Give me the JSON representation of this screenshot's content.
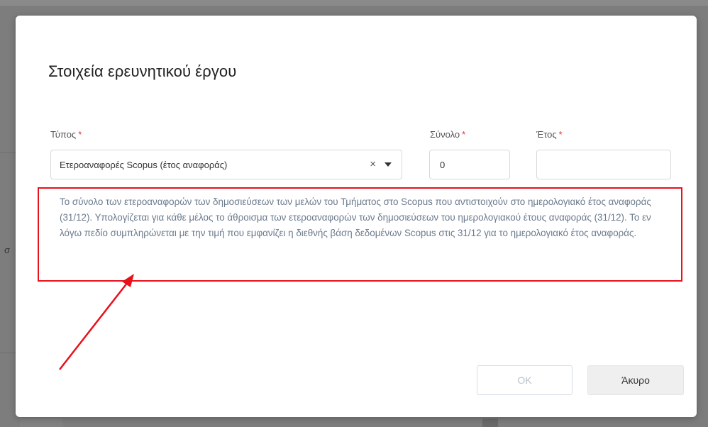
{
  "dialog": {
    "title": "Στοιχεία ερευνητικού έργου",
    "type_label": "Τύπος",
    "total_label": "Σύνολο",
    "year_label": "Έτος",
    "required_mark": "*",
    "type_value": "Ετεροαναφορές Scopus (έτος αναφοράς)",
    "clear_glyph": "×",
    "total_value": "0",
    "year_value": "",
    "help_text": "Το σύνολο των ετεροαναφορών των δημοσιεύσεων των μελών του Τμήματος στο Scopus που αντιστοιχούν στο ημερολογιακό έτος αναφοράς (31/12). Υπολογίζεται για κάθε μέλος το άθροισμα των ετεροαναφορών των δημοσιεύσεων του ημερολογιακού έτους αναφοράς (31/12). Το εν λόγω πεδίο συμπληρώνεται με την τιμή που εμφανίζει η διεθνής βάση δεδομένων Scopus στις 31/12 για το ημερολογιακό έτος αναφοράς.",
    "ok_label": "OK",
    "cancel_label": "Άκυρο"
  },
  "background": {
    "partial_glyph": "σ"
  },
  "colors": {
    "required": "#e3342f",
    "annotation_red": "#e8101b",
    "help_text": "#6b7a8c"
  },
  "icons": {
    "clear": "close-icon",
    "dropdown": "caret-down-icon"
  }
}
